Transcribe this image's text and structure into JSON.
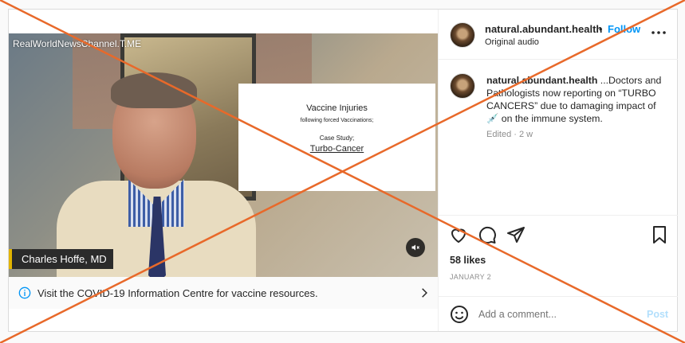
{
  "media": {
    "watermark": "RealWorldNewsChannel.T.ME",
    "slide": {
      "title": "Vaccine Injuries",
      "subtitle": "following forced Vaccinations;",
      "case": "Case Study;",
      "topic": "Turbo-Cancer"
    },
    "speaker": "Charles Hoffe, MD",
    "mute_icon": "speaker-muted-icon"
  },
  "info_bar": {
    "text": "Visit the COVID-19 Information Centre for vaccine resources."
  },
  "header": {
    "username": "natural.abundant.health",
    "dot": "•",
    "follow": "Follow",
    "audio": "Original audio"
  },
  "caption": {
    "username": "natural.abundant.health",
    "text": "...Doctors and Pathologists now reporting on “TURBO CANCERS” due to damaging impact of 💉 on the immune system.",
    "meta": "Edited · 2 w"
  },
  "stats": {
    "likes": "58 likes",
    "date": "JANUARY 2"
  },
  "comment_box": {
    "placeholder": "Add a comment...",
    "post": "Post"
  },
  "colors": {
    "follow": "#0095f6",
    "post_disabled": "#b2dffc",
    "overlay_cross": "#e8692a"
  }
}
